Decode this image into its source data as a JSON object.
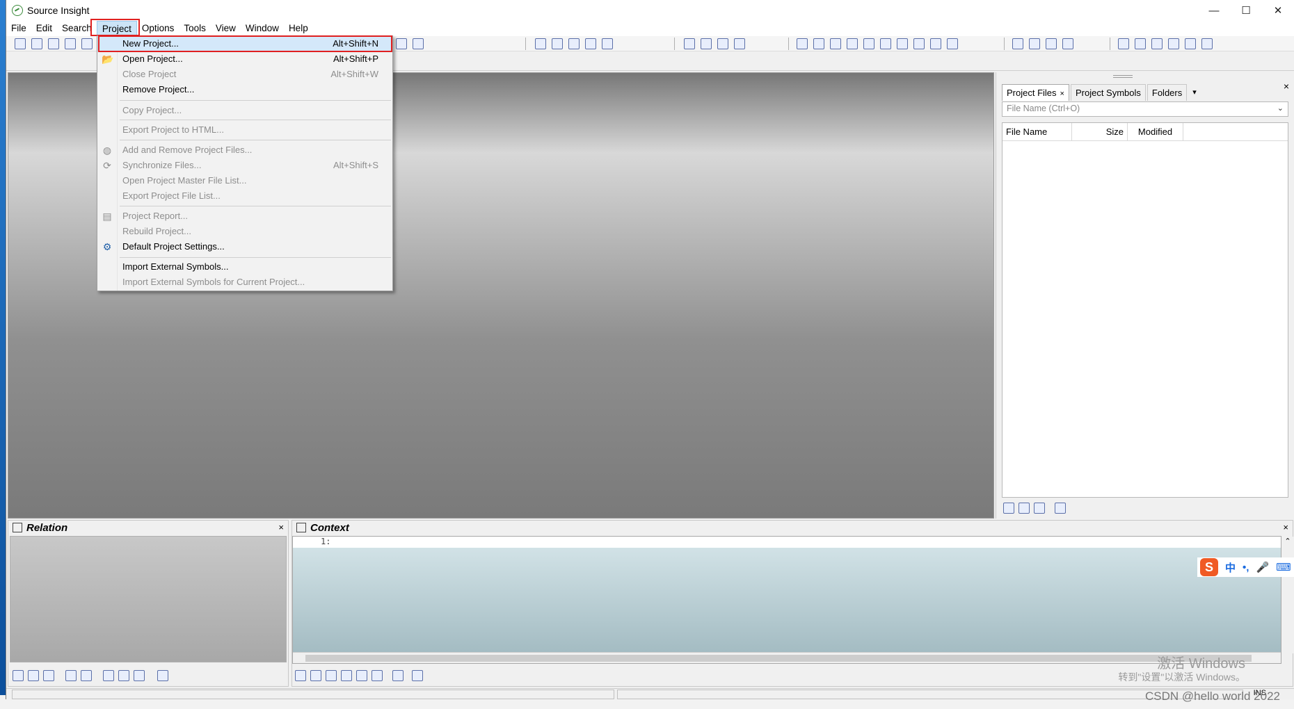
{
  "window": {
    "title": "Source Insight",
    "controls": {
      "minimize": "—",
      "maximize": "☐",
      "close": "✕"
    }
  },
  "menubar": [
    "File",
    "Edit",
    "Search",
    "Project",
    "Options",
    "Tools",
    "View",
    "Window",
    "Help"
  ],
  "project_menu": {
    "items": [
      {
        "label": "New Project...",
        "shortcut": "Alt+Shift+N",
        "enabled": true,
        "icon": ""
      },
      {
        "label": "Open Project...",
        "shortcut": "Alt+Shift+P",
        "enabled": true,
        "icon": "open-folder-icon"
      },
      {
        "label": "Close Project",
        "shortcut": "Alt+Shift+W",
        "enabled": false,
        "icon": ""
      },
      {
        "label": "Remove Project...",
        "shortcut": "",
        "enabled": true,
        "icon": ""
      },
      {
        "label": "Copy Project...",
        "shortcut": "",
        "enabled": false,
        "icon": ""
      },
      {
        "label": "Export Project to HTML...",
        "shortcut": "",
        "enabled": false,
        "icon": ""
      },
      {
        "label": "Add and Remove Project Files...",
        "shortcut": "",
        "enabled": false,
        "icon": "add-files-icon"
      },
      {
        "label": "Synchronize Files...",
        "shortcut": "Alt+Shift+S",
        "enabled": false,
        "icon": "sync-icon"
      },
      {
        "label": "Open Project Master File List...",
        "shortcut": "",
        "enabled": false,
        "icon": ""
      },
      {
        "label": "Export Project File List...",
        "shortcut": "",
        "enabled": false,
        "icon": ""
      },
      {
        "label": "Project Report...",
        "shortcut": "",
        "enabled": false,
        "icon": "report-icon"
      },
      {
        "label": "Rebuild Project...",
        "shortcut": "",
        "enabled": false,
        "icon": ""
      },
      {
        "label": "Default Project Settings...",
        "shortcut": "",
        "enabled": true,
        "icon": "gear-icon"
      },
      {
        "label": "Import External Symbols...",
        "shortcut": "",
        "enabled": true,
        "icon": ""
      },
      {
        "label": "Import External Symbols for Current Project...",
        "shortcut": "",
        "enabled": false,
        "icon": ""
      }
    ]
  },
  "right_panel": {
    "tabs": [
      "Project Files",
      "Project Symbols",
      "Folders"
    ],
    "tab_close": "×",
    "tab_more": "▾",
    "panel_close": "×",
    "search_placeholder": "File Name (Ctrl+O)",
    "columns": [
      "File Name",
      "Size",
      "Modified"
    ]
  },
  "relation_pane": {
    "title": "Relation",
    "close": "×"
  },
  "context_pane": {
    "title": "Context",
    "close": "×",
    "line_number": "1:"
  },
  "status": {
    "mode": "INS"
  },
  "overlays": {
    "activate_title": "激活 Windows",
    "activate_sub": "转到\"设置\"以激活 Windows。",
    "csdn": "CSDN @hello world 2022",
    "ime_label": "中",
    "ime_logo": "S"
  },
  "colors": {
    "highlight_red": "#e02020",
    "menu_hover": "#d4e8fa",
    "menu_active": "#cce4f7"
  }
}
